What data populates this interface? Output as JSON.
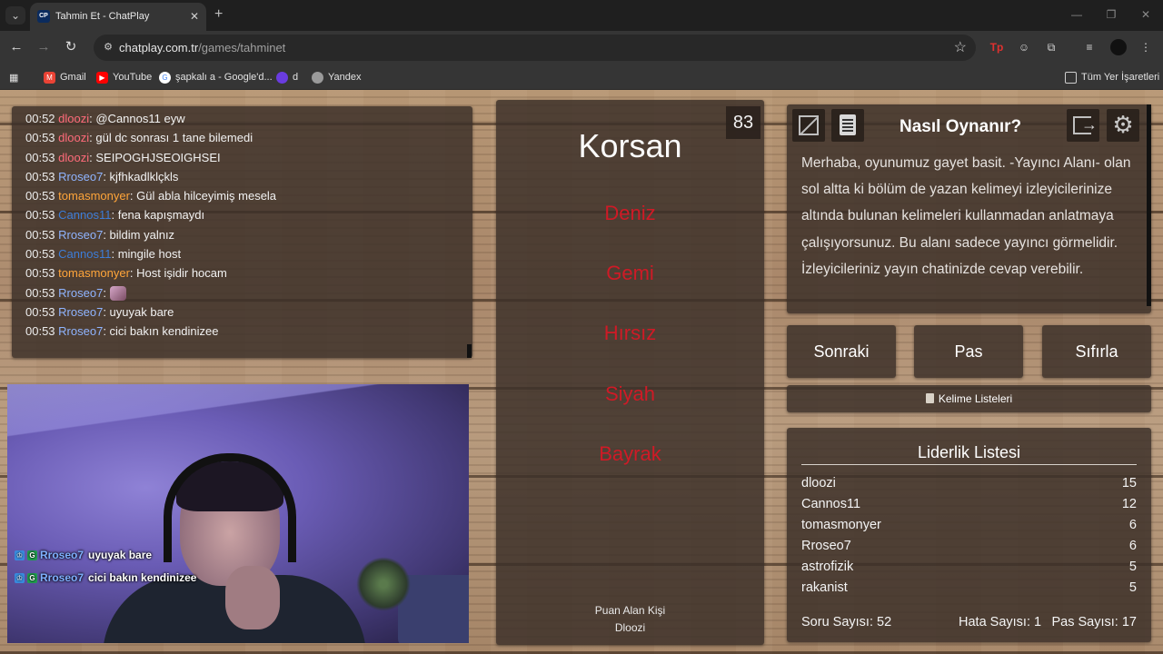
{
  "browser": {
    "tab_title": "Tahmin Et - ChatPlay",
    "tab_favicon": "CP",
    "url_host": "chatplay.com.tr",
    "url_path": "/games/tahminet",
    "bookmarks": [
      {
        "label": "Gmail",
        "icon": "gmail-icon",
        "color": "#ea4335"
      },
      {
        "label": "YouTube",
        "icon": "youtube-icon",
        "color": "#ff0000"
      },
      {
        "label": "şapkalı a - Google'd...",
        "icon": "google-icon",
        "color": "#ffffff"
      },
      {
        "label": "d",
        "icon": "site-icon",
        "color": "#6a3ce0"
      },
      {
        "label": "Yandex",
        "icon": "globe-icon",
        "color": "#9a9a9a"
      }
    ],
    "all_bookmarks": "Tüm Yer İşaretleri"
  },
  "chat": {
    "messages": [
      {
        "time": "00:52",
        "user": "dloozi",
        "color": "#ff6b7a",
        "text": ": @Cannos11 eyw"
      },
      {
        "time": "00:53",
        "user": "dloozi",
        "color": "#ff6b7a",
        "text": ": gül dc sonrası 1 tane bilemedi"
      },
      {
        "time": "00:53",
        "user": "dloozi",
        "color": "#ff6b7a",
        "text": ": SEIPOGHJSEOIGHSEI"
      },
      {
        "time": "00:53",
        "user": "Rroseo7",
        "color": "#8fb4ff",
        "text": ": kjfhkadlklçkls"
      },
      {
        "time": "00:53",
        "user": "tomasmonyer",
        "color": "#ffa53a",
        "text": ": Gül abla hilceyimiş mesela"
      },
      {
        "time": "00:53",
        "user": "Cannos11",
        "color": "#3d7dd8",
        "text": ": fena kapışmaydı"
      },
      {
        "time": "00:53",
        "user": "Rroseo7",
        "color": "#8fb4ff",
        "text": ": bildim yalnız"
      },
      {
        "time": "00:53",
        "user": "Cannos11",
        "color": "#3d7dd8",
        "text": ": mingile host"
      },
      {
        "time": "00:53",
        "user": "tomasmonyer",
        "color": "#ffa53a",
        "text": ": Host işidir hocam"
      },
      {
        "time": "00:53",
        "user": "Rroseo7",
        "color": "#8fb4ff",
        "text": ":"
      },
      {
        "time": "00:53",
        "user": "Rroseo7",
        "color": "#8fb4ff",
        "text": ": uyuyak bare"
      },
      {
        "time": "00:53",
        "user": "Rroseo7",
        "color": "#8fb4ff",
        "text": ": cici bakın kendinizee"
      }
    ]
  },
  "stream_overlay": [
    {
      "user": "Rroseo7",
      "text": "uyuyak bare"
    },
    {
      "user": "Rroseo7",
      "text": "cici bakın kendinizee"
    }
  ],
  "card": {
    "score": "83",
    "target_word": "Korsan",
    "forbidden": [
      "Deniz",
      "Gemi",
      "Hırsız",
      "Siyah",
      "Bayrak"
    ],
    "scorer_label": "Puan Alan Kişi",
    "scorer_name": "Dloozi"
  },
  "howto": {
    "title": "Nasıl Oynanır?",
    "text": "Merhaba, oyunumuz gayet basit. -Yayıncı Alanı- olan sol altta ki bölüm de yazan kelimeyi izleyicilerinize altında bulunan kelimeleri kullanmadan anlatmaya çalışıyorsunuz. Bu alanı sadece yayıncı görmelidir. İzleyicileriniz yayın chatinizde cevap verebilir."
  },
  "controls": {
    "next": "Sonraki",
    "pass": "Pas",
    "reset": "Sıfırla",
    "word_lists": "Kelime Listeleri"
  },
  "leaderboard": {
    "title": "Liderlik Listesi",
    "rows": [
      {
        "name": "dloozi",
        "score": "15"
      },
      {
        "name": "Cannos11",
        "score": "12"
      },
      {
        "name": "tomasmonyer",
        "score": "6"
      },
      {
        "name": "Rroseo7",
        "score": "6"
      },
      {
        "name": "astrofizik",
        "score": "5"
      },
      {
        "name": "rakanist",
        "score": "5"
      }
    ],
    "questions": "Soru Sayısı: 52",
    "errors": "Hata Sayısı: 1",
    "passes": "Pas Sayısı: 17"
  }
}
